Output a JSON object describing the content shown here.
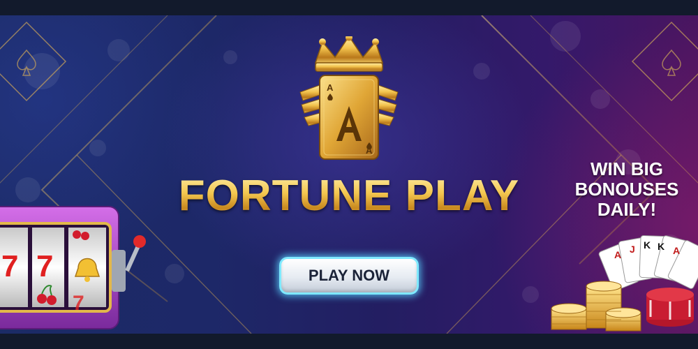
{
  "brand": {
    "name": "FORTUNE PLAY",
    "card_letter": "A",
    "card_corner": "A"
  },
  "cta": {
    "label": "PLAY NOW"
  },
  "promo": {
    "lines": [
      "WIN BIG",
      "BONOUSES",
      "DAILY!"
    ]
  },
  "slot_machine": {
    "reels": [
      "7",
      "7",
      "7"
    ]
  },
  "playing_cards": [
    "A",
    "J",
    "K",
    "K",
    "A"
  ],
  "colors": {
    "gold": "#f3c64f",
    "button_glow": "#7fe9ff",
    "bg_left": "#1c2b66",
    "bg_right": "#4a1560"
  }
}
